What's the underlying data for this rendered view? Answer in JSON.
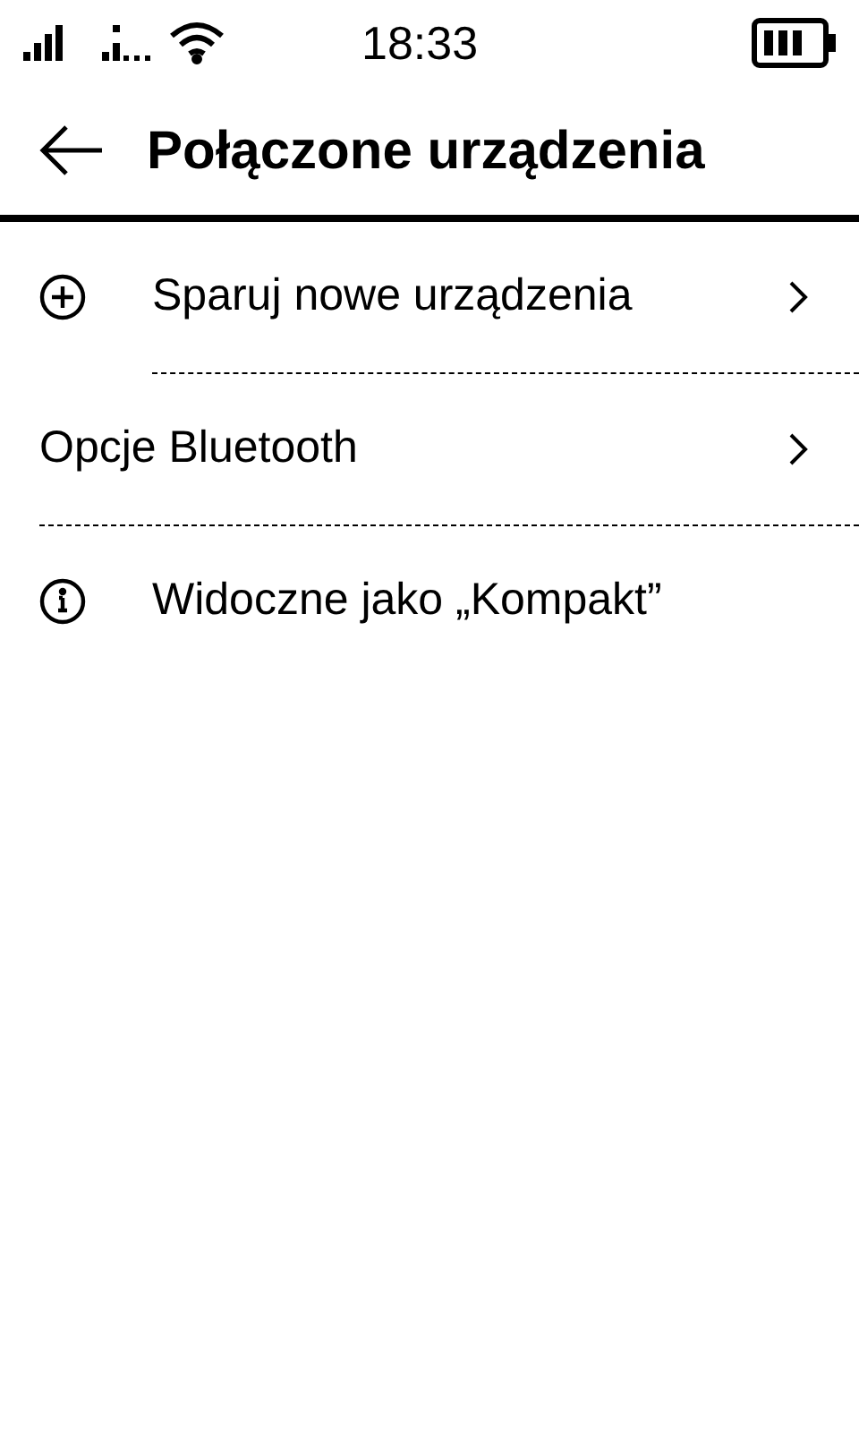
{
  "status_bar": {
    "time": "18:33"
  },
  "header": {
    "title": "Połączone urządzenia"
  },
  "items": [
    {
      "kind": "add",
      "label": "Sparuj nowe urządzenia",
      "chevron": true
    },
    {
      "kind": "plain",
      "label": "Opcje Bluetooth",
      "chevron": true
    },
    {
      "kind": "info",
      "label": "Widoczne jako „Kompakt”",
      "chevron": false
    }
  ]
}
